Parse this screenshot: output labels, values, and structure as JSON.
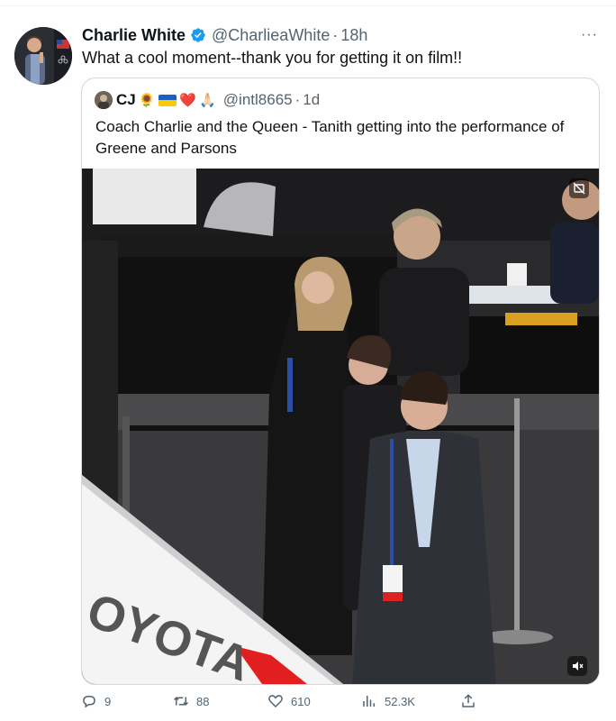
{
  "tweet": {
    "author_name": "Charlie White",
    "author_handle": "@CharlieaWhite",
    "time": "18h",
    "text": "What a cool moment--thank you for getting it on film!!"
  },
  "quote": {
    "author_name": "CJ",
    "author_emojis": [
      "🌻",
      "❤️",
      "🙏🏻"
    ],
    "author_handle": "@intl8665",
    "time": "1d",
    "text": "Coach Charlie and the Queen - Tanith getting into the performance of Greene and Parsons",
    "media_banner_text": "OYOTA"
  },
  "actions": {
    "replies": "9",
    "retweets": "88",
    "likes": "610",
    "views": "52.3K"
  },
  "colors": {
    "verified": "#1d9bf0",
    "secondary_text": "#536471",
    "border": "#cfd9de"
  },
  "icons": [
    "verified-badge-icon",
    "more-icon",
    "reply-icon",
    "retweet-icon",
    "like-icon",
    "views-icon",
    "share-icon",
    "mute-icon",
    "media-settings-icon"
  ]
}
